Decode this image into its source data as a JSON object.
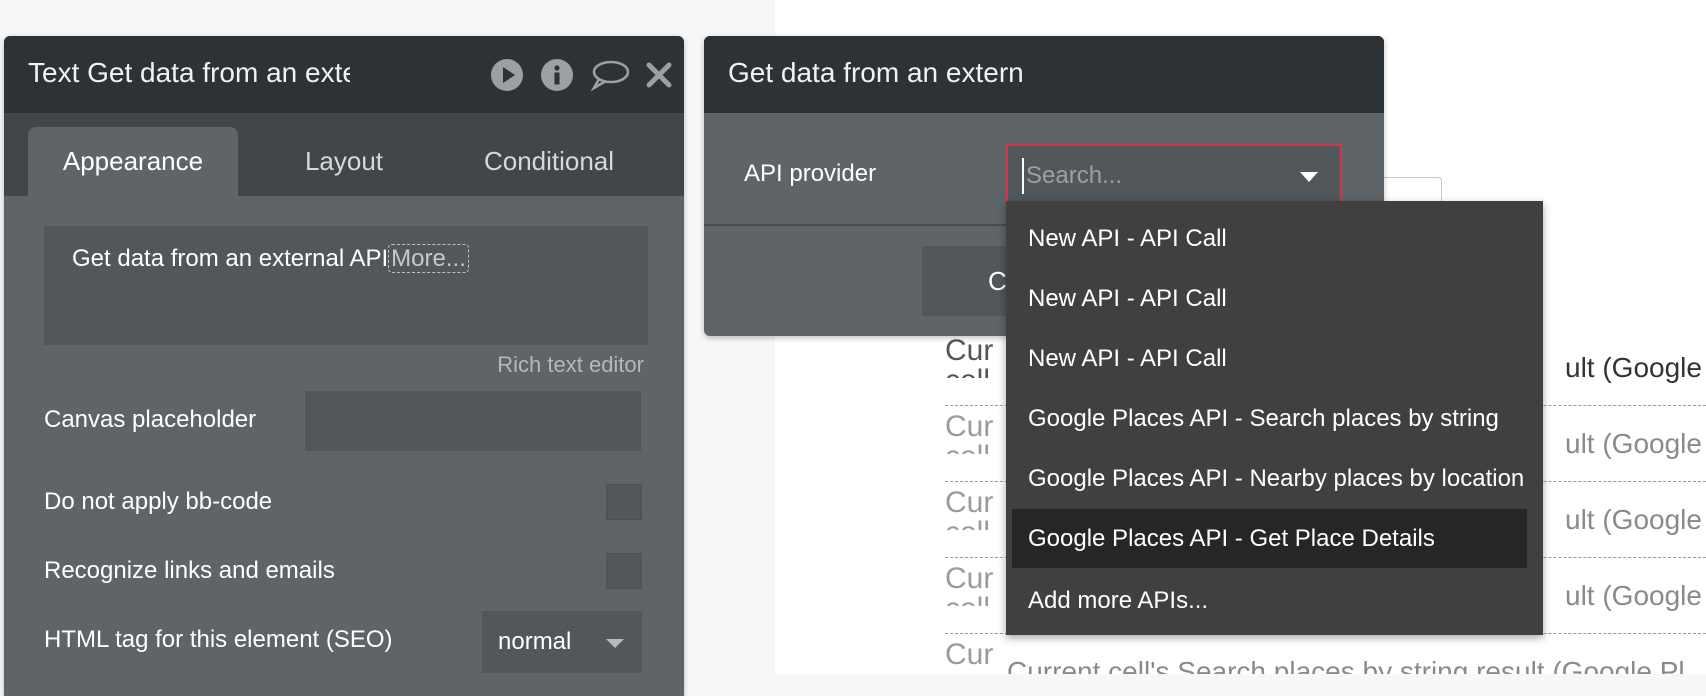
{
  "property_panel": {
    "title": "Text Get data from an external API",
    "tabs": [
      "Appearance",
      "Layout",
      "Conditional"
    ],
    "text_value": "Get data from an external API",
    "more_link": "More...",
    "rich_text_editor": "Rich text editor",
    "canvas_placeholder_label": "Canvas placeholder",
    "no_bbcode_label": "Do not apply bb-code",
    "recognize_links_label": "Recognize links and emails",
    "html_tag_label": "HTML tag for this element (SEO)",
    "html_tag_value": "normal"
  },
  "data_dialog": {
    "title": "Get data from an extern",
    "api_provider_label": "API provider",
    "button_partial": "C",
    "search_placeholder": "Search..."
  },
  "dropdown": {
    "options": [
      "New API - API Call",
      "New API - API Call",
      "New API - API Call",
      "Google Places API - Search places by string",
      "Google Places API - Nearby places by location",
      "Google Places API - Get Place Details",
      "Add more APIs..."
    ],
    "selected": "Google Places API - Get Place Details"
  },
  "background_rows": [
    {
      "cur": "Cur",
      "cell": "cell",
      "text": "ult (Google Pl"
    },
    {
      "cur": "Cur",
      "cell": "cell",
      "text": "ult (Google Pl"
    },
    {
      "cur": "Cur",
      "cell": "cell",
      "text": "ult (Google Pl"
    },
    {
      "cur": "Cur",
      "cell": "cell",
      "text": "ult (Google Pl"
    },
    {
      "cur": "Cur",
      "cell": "",
      "text": "Current cell's Search places by string result (Google Pl"
    }
  ],
  "colors": {
    "panel_bg": "#5e6468",
    "header_bg": "#2c3236",
    "menu_bg": "#404040",
    "focus_border": "#d1364e"
  }
}
